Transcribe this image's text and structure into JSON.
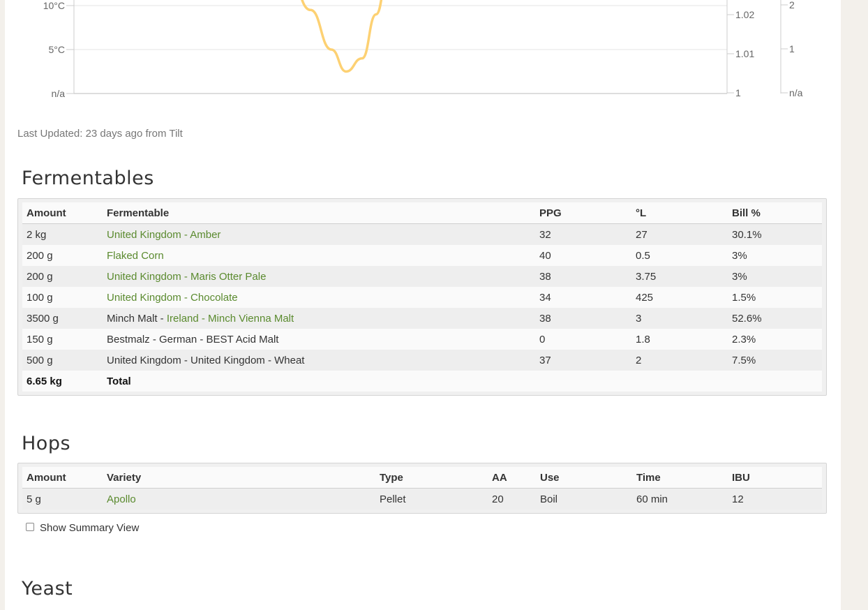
{
  "chart": {
    "left_axis_ticks": [
      "10°C",
      "5°C",
      "n/a"
    ],
    "sg_axis_ticks": [
      "1.02",
      "1.01",
      "1"
    ],
    "right_axis_ticks": [
      "2",
      "1",
      "n/a"
    ],
    "series_color": "#fdd173"
  },
  "chart_data": {
    "type": "line",
    "title": "",
    "xlabel": "",
    "ylabel": "",
    "ylim": [
      0,
      10
    ],
    "series": [
      {
        "values": [
          14,
          9.5,
          5,
          2.5,
          4,
          9,
          14
        ]
      }
    ],
    "grid": true
  },
  "last_updated": "Last Updated: 23 days ago from Tilt",
  "fermentables": {
    "heading": "Fermentables",
    "columns": [
      "Amount",
      "Fermentable",
      "PPG",
      "°L",
      "Bill %"
    ],
    "rows": [
      {
        "amount": "2 kg",
        "prefix": "",
        "name": "United Kingdom - Amber",
        "linked": true,
        "ppg": "32",
        "lovibond": "27",
        "bill": "30.1%"
      },
      {
        "amount": "200 g",
        "prefix": "",
        "name": "Flaked Corn",
        "linked": true,
        "ppg": "40",
        "lovibond": "0.5",
        "bill": "3%"
      },
      {
        "amount": "200 g",
        "prefix": "",
        "name": "United Kingdom - Maris Otter Pale",
        "linked": true,
        "ppg": "38",
        "lovibond": "3.75",
        "bill": "3%"
      },
      {
        "amount": "100 g",
        "prefix": "",
        "name": "United Kingdom - Chocolate",
        "linked": true,
        "ppg": "34",
        "lovibond": "425",
        "bill": "1.5%"
      },
      {
        "amount": "3500 g",
        "prefix": "Minch Malt - ",
        "name": "Ireland - Minch Vienna Malt",
        "linked": true,
        "ppg": "38",
        "lovibond": "3",
        "bill": "52.6%"
      },
      {
        "amount": "150 g",
        "prefix": "",
        "name": "Bestmalz - German - BEST Acid Malt",
        "linked": false,
        "ppg": "0",
        "lovibond": "1.8",
        "bill": "2.3%"
      },
      {
        "amount": "500 g",
        "prefix": "",
        "name": "United Kingdom - United Kingdom - Wheat",
        "linked": false,
        "ppg": "37",
        "lovibond": "2",
        "bill": "7.5%"
      }
    ],
    "total": {
      "amount": "6.65 kg",
      "label": "Total"
    }
  },
  "hops": {
    "heading": "Hops",
    "columns": [
      "Amount",
      "Variety",
      "Type",
      "AA",
      "Use",
      "Time",
      "IBU"
    ],
    "rows": [
      {
        "amount": "5 g",
        "variety": "Apollo",
        "type": "Pellet",
        "aa": "20",
        "use": "Boil",
        "time": "60 min",
        "ibu": "12"
      }
    ],
    "summary_toggle_label": "Show Summary View",
    "summary_toggle_checked": false
  },
  "yeast": {
    "heading": "Yeast"
  }
}
